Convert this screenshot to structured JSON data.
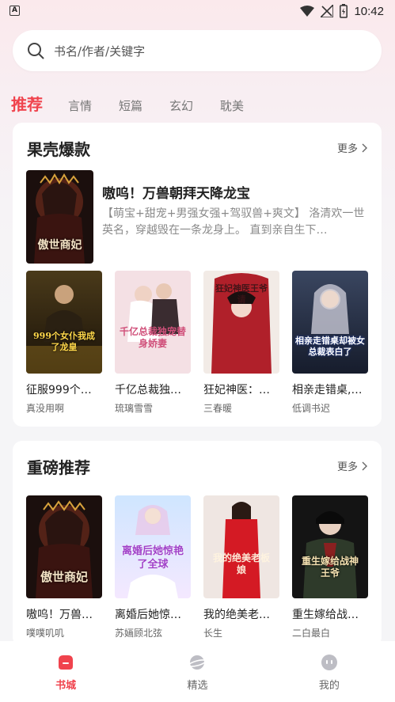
{
  "status_bar": {
    "time": "10:42",
    "notification_icon": "A"
  },
  "search": {
    "placeholder": "书名/作者/关键字"
  },
  "tabs": [
    {
      "label": "推荐",
      "active": true
    },
    {
      "label": "言情"
    },
    {
      "label": "短篇"
    },
    {
      "label": "玄幻"
    },
    {
      "label": "耽美"
    }
  ],
  "section1": {
    "title": "果壳爆款",
    "more_label": "更多",
    "featured": {
      "title": "嗷呜！万兽朝拜天降龙宝",
      "description": "【萌宝+甜宠+男强女强+驾驭兽+爽文】 洛清欢一世英名，穿越毁在一条龙身上。 直到亲自生下…",
      "cover_text": "傲世商妃"
    },
    "books": [
      {
        "title": "征服999个…",
        "author": "真没用啊",
        "cover_text": "999个女仆我成了龙皇"
      },
      {
        "title": "千亿总裁独…",
        "author": "琉璃雪雪",
        "cover_text": "千亿总裁独宠替身娇妻"
      },
      {
        "title": "狂妃神医：…",
        "author": "三春暖",
        "cover_text": "狂妃神医王爷请"
      },
      {
        "title": "相亲走错桌,…",
        "author": "低调书迟",
        "cover_text": "相亲走错桌却被女总裁表白了"
      }
    ]
  },
  "section2": {
    "title": "重磅推荐",
    "more_label": "更多",
    "books": [
      {
        "title": "嗷呜！万兽…",
        "author": "噗噗叽叽",
        "cover_text": "傲世商妃"
      },
      {
        "title": "离婚后她惊…",
        "author": "苏婳顾北弦",
        "cover_text": "离婚后她惊艳了全球"
      },
      {
        "title": "我的绝美老…",
        "author": "长生",
        "cover_text": "我的绝美老板娘"
      },
      {
        "title": "重生嫁给战…",
        "author": "二白最白",
        "cover_text": "重生嫁给战神王爷"
      }
    ]
  },
  "bottom_nav": [
    {
      "label": "书城",
      "icon": "bookstore-icon",
      "active": true
    },
    {
      "label": "精选",
      "icon": "planet-icon"
    },
    {
      "label": "我的",
      "icon": "profile-icon"
    }
  ],
  "colors": {
    "accent": "#f0434d",
    "background": "#f5f5f7",
    "card": "#ffffff"
  }
}
